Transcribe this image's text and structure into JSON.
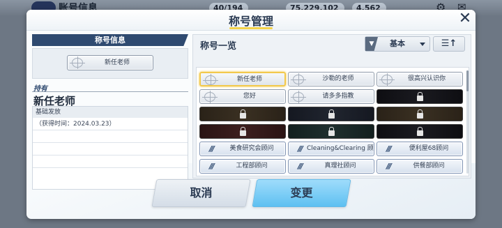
{
  "hud": {
    "title": "账号信息",
    "ap": "40/194",
    "credits": "75,229,102",
    "gems": "4,562"
  },
  "modal": {
    "title": "称号管理",
    "close_icon": "close-icon"
  },
  "left": {
    "section_title": "称号信息",
    "current_badge": "新任老师",
    "hold_label": "持有",
    "held_name": "新任老师",
    "desc_header": "基础发放",
    "desc_rows": [
      "（获得时间：2024.03.23）",
      "",
      "",
      ""
    ]
  },
  "right": {
    "title": "称号一览",
    "filter_label": "基本",
    "sort_icon": "sort-icon",
    "badges": [
      {
        "label": "新任老师",
        "style": "plain",
        "selected": true
      },
      {
        "label": "沙勒的老师",
        "style": "plain",
        "selected": false
      },
      {
        "label": "很高兴认识你",
        "style": "plain",
        "selected": false
      },
      {
        "label": "您好",
        "style": "plain",
        "selected": false
      },
      {
        "label": "请多多指教",
        "style": "plain",
        "selected": false
      },
      {
        "label": "",
        "style": "locked-black",
        "selected": false
      },
      {
        "label": "",
        "style": "locked-brown",
        "selected": false
      },
      {
        "label": "",
        "style": "locked-dark",
        "selected": false
      },
      {
        "label": "",
        "style": "locked-brown",
        "selected": false
      },
      {
        "label": "",
        "style": "locked-maroon",
        "selected": false
      },
      {
        "label": "",
        "style": "locked-darkteal",
        "selected": false
      },
      {
        "label": "",
        "style": "locked-black",
        "selected": false
      },
      {
        "label": "美食研究会顾问",
        "style": "blue",
        "selected": false
      },
      {
        "label": "Cleaning&Clearing 顾问",
        "style": "blue",
        "selected": false
      },
      {
        "label": "便利屋68顾问",
        "style": "blue",
        "selected": false
      },
      {
        "label": "工程部顾问",
        "style": "blue",
        "selected": false
      },
      {
        "label": "真理社顾问",
        "style": "blue",
        "selected": false
      },
      {
        "label": "供餐部顾问",
        "style": "blue",
        "selected": false
      }
    ]
  },
  "buttons": {
    "cancel": "取消",
    "confirm": "变更"
  },
  "colors": {
    "accent_yellow": "#f2c94c",
    "primary_blue": "#5ec0f1",
    "navy": "#2f4a70"
  }
}
